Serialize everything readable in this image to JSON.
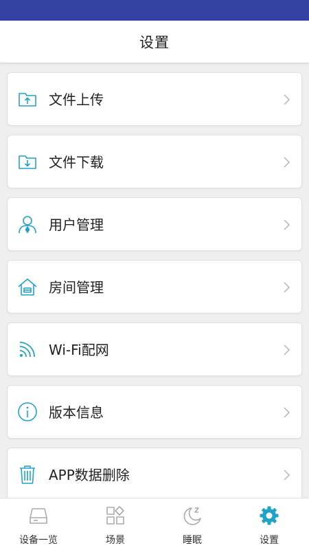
{
  "header": {
    "title": "设置"
  },
  "colors": {
    "status_bar": "#3441a1",
    "accent": "#1fa3c9",
    "tab_inactive": "#aaaaaa"
  },
  "settings": {
    "items": [
      {
        "label": "文件上传",
        "icon": "folder-upload-icon"
      },
      {
        "label": "文件下载",
        "icon": "folder-download-icon"
      },
      {
        "label": "用户管理",
        "icon": "user-manage-icon"
      },
      {
        "label": "房间管理",
        "icon": "house-icon"
      },
      {
        "label": "Wi-Fi配网",
        "icon": "wifi-icon"
      },
      {
        "label": "版本信息",
        "icon": "info-icon"
      },
      {
        "label": "APP数据删除",
        "icon": "trash-icon"
      }
    ]
  },
  "tabbar": {
    "tabs": [
      {
        "label": "设备一览",
        "icon": "device-icon",
        "active": false
      },
      {
        "label": "场景",
        "icon": "scene-grid-icon",
        "active": false
      },
      {
        "label": "睡眠",
        "icon": "moon-icon",
        "active": false
      },
      {
        "label": "设置",
        "icon": "gear-icon",
        "active": true
      }
    ]
  }
}
